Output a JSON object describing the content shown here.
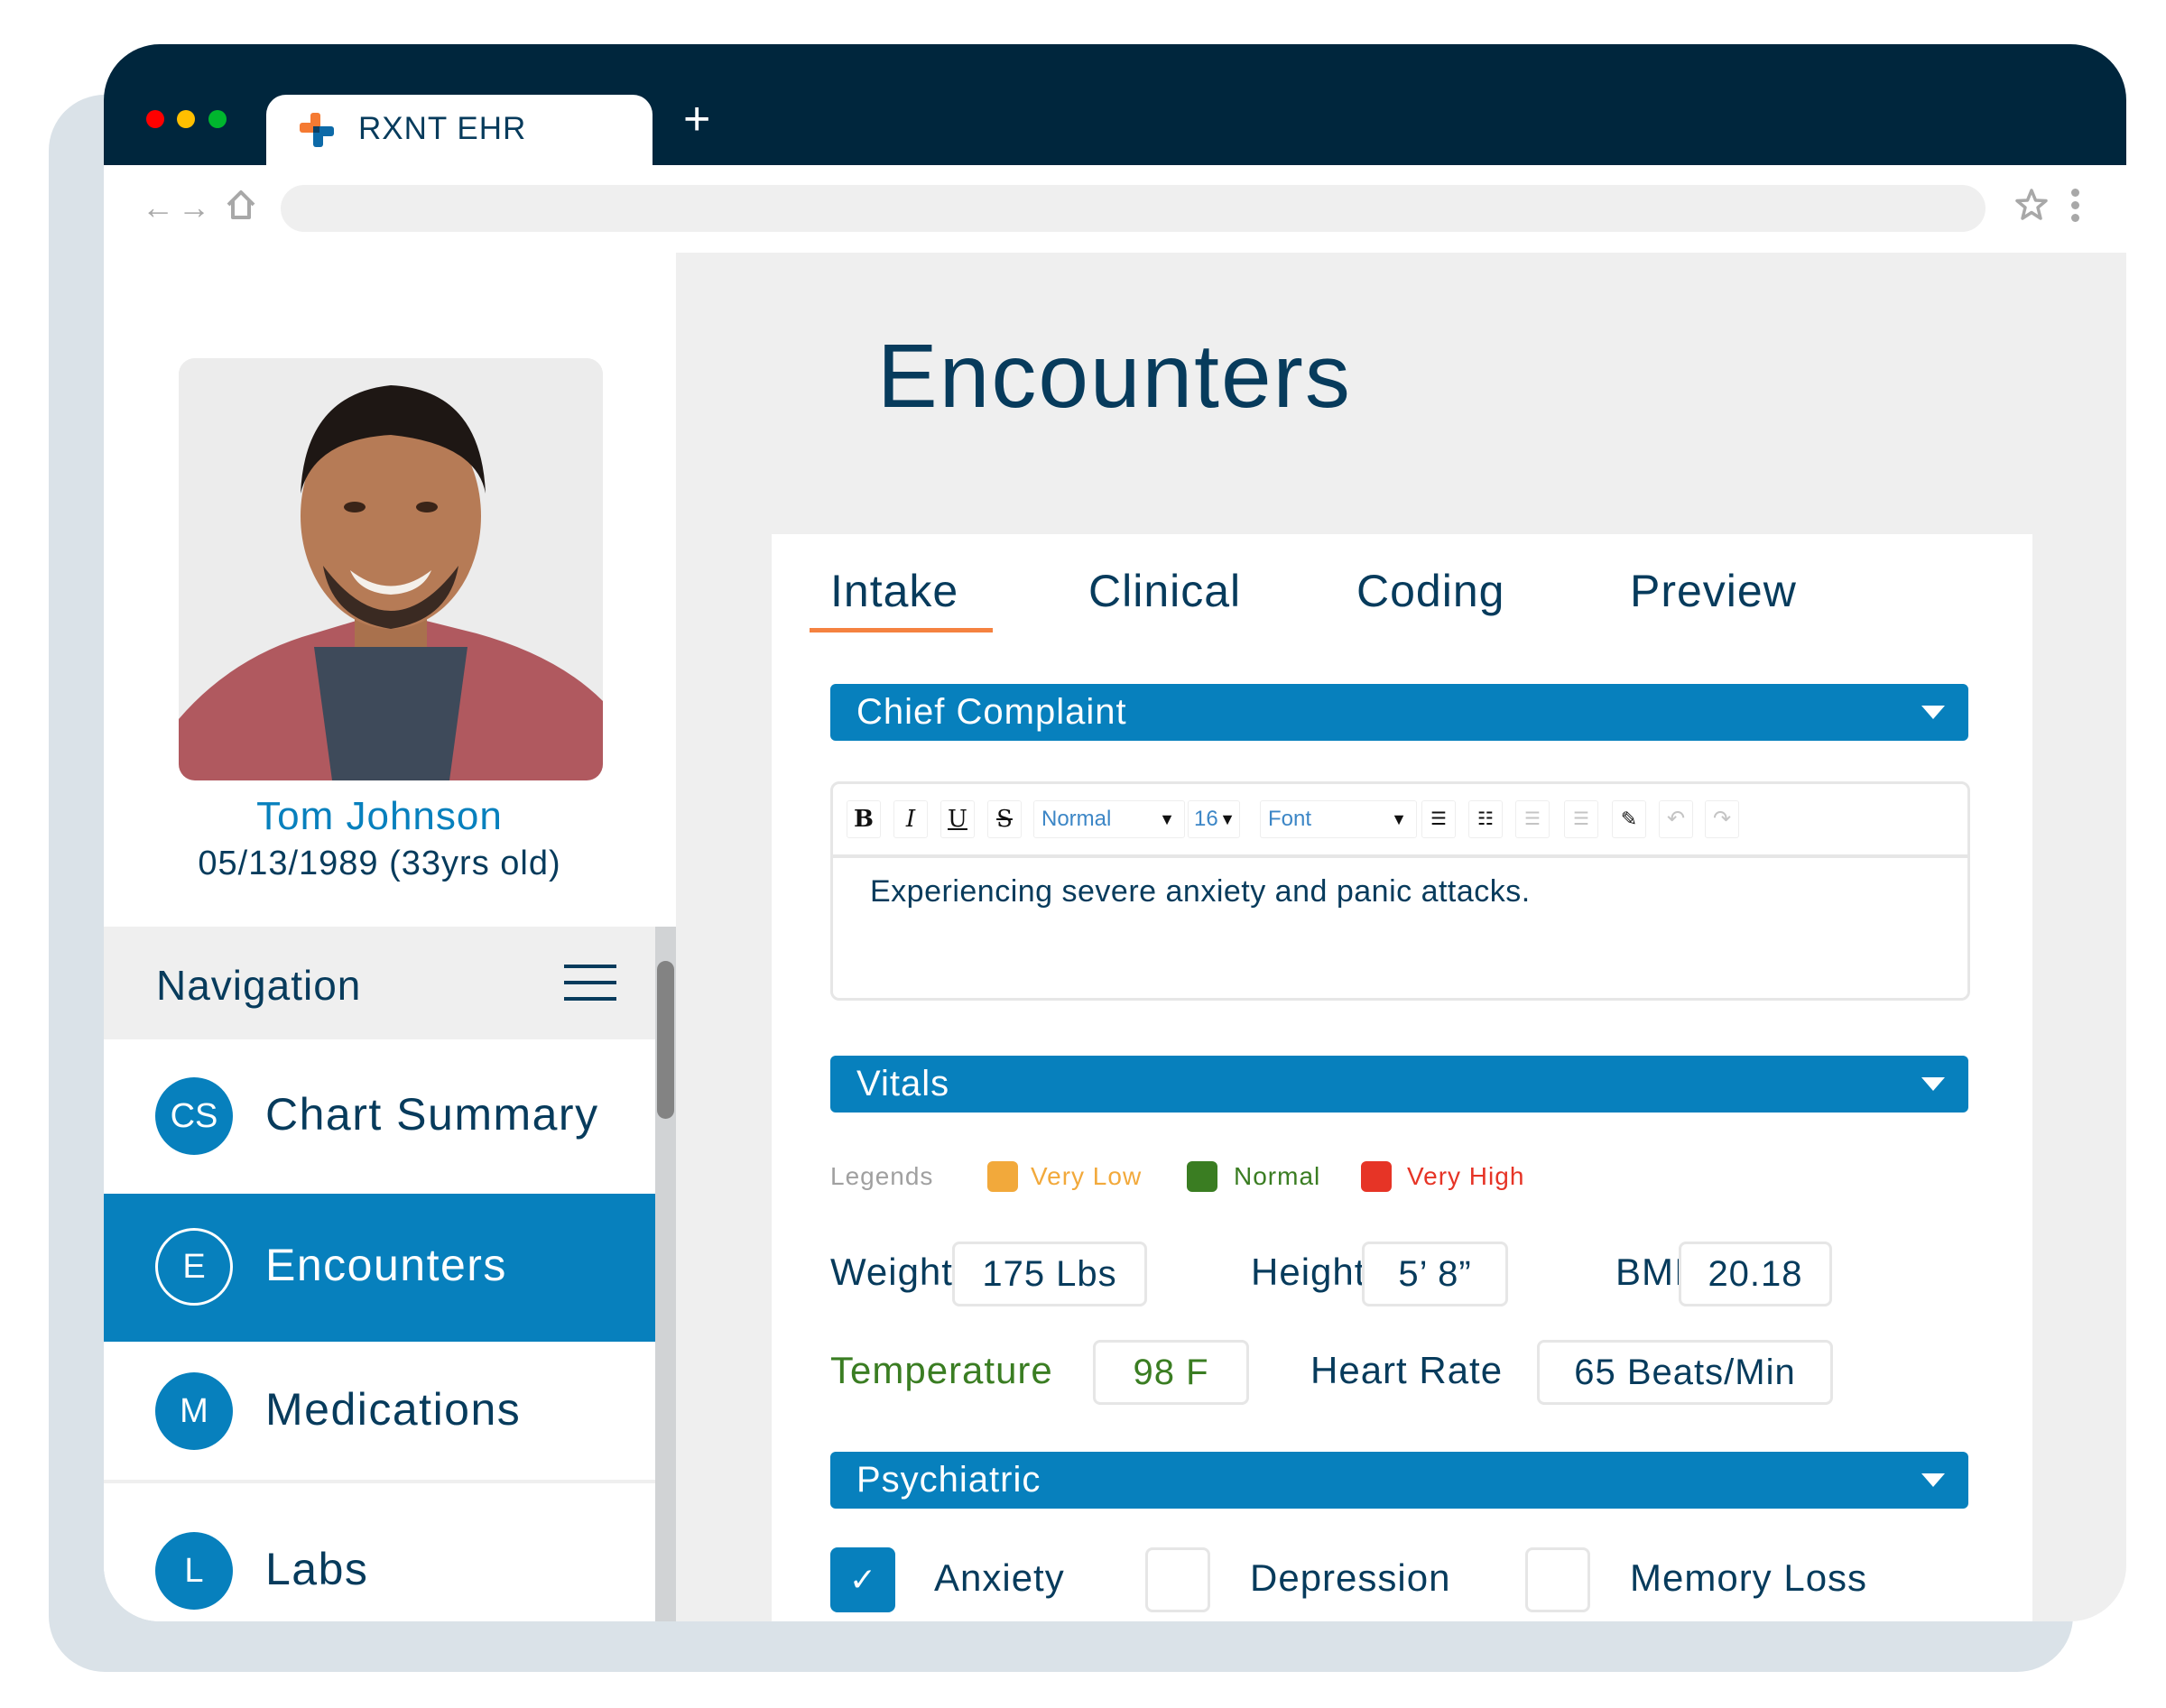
{
  "browser": {
    "tab_title": "RXNT EHR",
    "new_tab_label": "+",
    "nav_arrows": "←→",
    "address": "",
    "icons": [
      "back-arrow-icon",
      "forward-arrow-icon",
      "home-icon",
      "star-icon",
      "kebab-menu-icon"
    ]
  },
  "patient": {
    "name": "Tom Johnson",
    "dob": "05/13/1989 (33yrs old)"
  },
  "navigation": {
    "title": "Navigation",
    "items": [
      {
        "initials": "CS",
        "label": "Chart Summary",
        "active": false
      },
      {
        "initials": "E",
        "label": "Encounters",
        "active": true
      },
      {
        "initials": "M",
        "label": "Medications",
        "active": false
      },
      {
        "initials": "L",
        "label": "Labs",
        "active": false
      }
    ]
  },
  "page": {
    "title": "Encounters",
    "tabs": [
      {
        "label": "Intake",
        "active": true
      },
      {
        "label": "Clinical",
        "active": false
      },
      {
        "label": "Coding",
        "active": false
      },
      {
        "label": "Preview",
        "active": false
      }
    ]
  },
  "chief_complaint": {
    "section_title": "Chief Complaint",
    "toolbar": {
      "bold": "B",
      "italic": "I",
      "underline": "U",
      "strike": "S",
      "style_select": "Normal",
      "size_select": "16",
      "font_select": "Font"
    },
    "text": "Experiencing severe anxiety and panic attacks."
  },
  "vitals": {
    "section_title": "Vitals",
    "legends_label": "Legends",
    "legends": [
      {
        "label": "Very Low",
        "color": "#f2a93b"
      },
      {
        "label": "Normal",
        "color": "#3a7d22"
      },
      {
        "label": "Very High",
        "color": "#e63426"
      }
    ],
    "fields": {
      "weight": {
        "label": "Weight",
        "value": "175 Lbs"
      },
      "height": {
        "label": "Height",
        "value": "5’ 8”"
      },
      "bmi": {
        "label": "BMI",
        "value": "20.18"
      },
      "temperature": {
        "label": "Temperature",
        "value": "98 F",
        "status": "Normal"
      },
      "heart_rate": {
        "label": "Heart Rate",
        "value": "65 Beats/Min"
      }
    }
  },
  "psychiatric": {
    "section_title": "Psychiatric",
    "options": [
      {
        "label": "Anxiety",
        "checked": true
      },
      {
        "label": "Depression",
        "checked": false
      },
      {
        "label": "Memory Loss",
        "checked": false
      }
    ]
  },
  "colors": {
    "primary": "#0780bd",
    "navy": "#073b5c",
    "header": "#00263d",
    "accent_tab": "#f58240"
  }
}
